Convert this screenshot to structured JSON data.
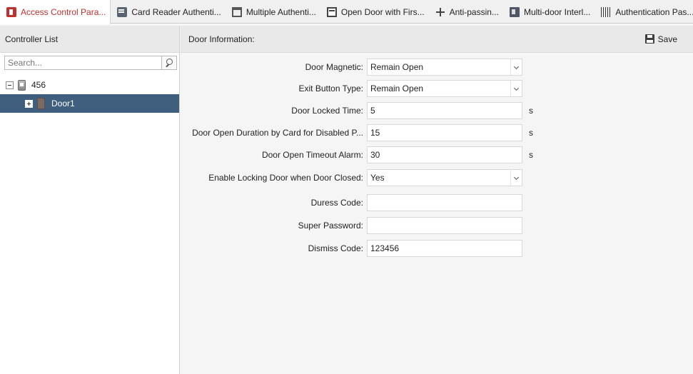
{
  "tabs": [
    {
      "label": "Access Control Para...",
      "icon": "access-control-icon",
      "active": true
    },
    {
      "label": "Card Reader Authenti...",
      "icon": "card-reader-icon",
      "active": false
    },
    {
      "label": "Multiple Authenti...",
      "icon": "multiple-auth-icon",
      "active": false
    },
    {
      "label": "Open Door with Firs...",
      "icon": "first-card-icon",
      "active": false
    },
    {
      "label": "Anti-passin...",
      "icon": "anti-passback-icon",
      "active": false
    },
    {
      "label": "Multi-door Interl...",
      "icon": "interlock-icon",
      "active": false
    },
    {
      "label": "Authentication Pas...",
      "icon": "barcode-icon",
      "active": false
    }
  ],
  "left_panel": {
    "title": "Controller List",
    "search": {
      "placeholder": "Search...",
      "value": ""
    },
    "tree": [
      {
        "label": "456",
        "type": "controller",
        "expanded": true
      },
      {
        "label": "Door1",
        "type": "door",
        "selected": true
      }
    ]
  },
  "right_panel": {
    "title": "Door Information:",
    "save_label": "Save",
    "fields": [
      {
        "label": "Door Magnetic:",
        "value": "Remain Open",
        "kind": "select"
      },
      {
        "label": "Exit Button Type:",
        "value": "Remain Open",
        "kind": "select"
      },
      {
        "label": "Door Locked Time:",
        "value": "5",
        "kind": "input",
        "unit": "s"
      },
      {
        "label": "Door Open Duration by Card for Disabled P...",
        "value": "15",
        "kind": "input",
        "unit": "s"
      },
      {
        "label": "Door Open Timeout Alarm:",
        "value": "30",
        "kind": "input",
        "unit": "s"
      },
      {
        "label": "Enable Locking Door when Door Closed:",
        "value": "Yes",
        "kind": "select"
      },
      {
        "label": "Duress Code:",
        "value": "",
        "kind": "input"
      },
      {
        "label": "Super Password:",
        "value": "",
        "kind": "input"
      },
      {
        "label": "Dismiss Code:",
        "value": "123456",
        "kind": "input"
      }
    ]
  },
  "colors": {
    "active_tab_text": "#c0302f",
    "selected_row": "#405f7f"
  }
}
